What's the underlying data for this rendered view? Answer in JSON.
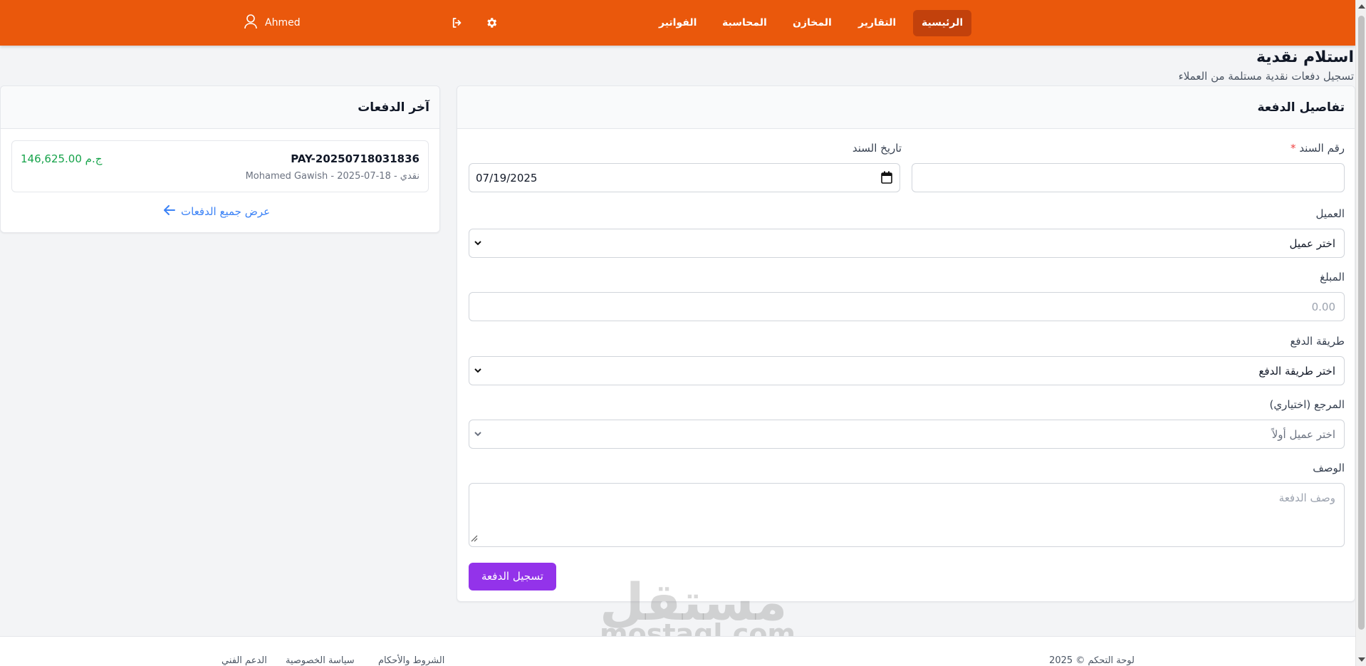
{
  "nav": {
    "items": [
      {
        "label": "الرئيسية",
        "active": true
      },
      {
        "label": "التقارير",
        "active": false
      },
      {
        "label": "المخازن",
        "active": false
      },
      {
        "label": "المحاسبة",
        "active": false
      },
      {
        "label": "الفواتير",
        "active": false
      }
    ],
    "user_name": "Ahmed",
    "icons": [
      "settings-icon",
      "logout-icon",
      "user-icon"
    ],
    "colors": {
      "navbar": "#ea580c",
      "active_item": "#c2410c"
    }
  },
  "page": {
    "title": "استلام نقدية",
    "subtitle": "تسجيل دفعات نقدية مستلمة من العملاء"
  },
  "form": {
    "card_title": "تفاصيل الدفعة",
    "voucher_no_label": "رقم السند",
    "required_mark": "*",
    "voucher_no_value": "",
    "voucher_date_label": "تاريخ السند",
    "voucher_date_value": "07/19/2025",
    "customer_label": "العميل",
    "customer_value": "اختر عميل",
    "amount_label": "المبلغ",
    "amount_placeholder": "0.00",
    "method_label": "طريقة الدفع",
    "method_value": "اختر طريقة الدفع",
    "reference_label": "المرجع (اختياري)",
    "reference_value": "اختر عميل أولاً",
    "description_label": "الوصف",
    "description_placeholder": "وصف الدفعة",
    "submit_label": "تسجيل الدفعة",
    "submit_color": "#9333ea"
  },
  "recent": {
    "card_title": "آخر الدفعات",
    "payments": [
      {
        "number": "PAY-20250718031836",
        "meta": "Mohamed Gawish - نقدي - 18-07-2025",
        "amount": "146,625.00 ج.م",
        "amount_color": "#16a34a"
      }
    ],
    "view_all_label": "عرض جميع الدفعات"
  },
  "watermark": {
    "arabic": "مستقل",
    "latin": "mostaql.com"
  },
  "footer": {
    "copyright": "لوحة التحكم © 2025",
    "links": [
      "الشروط والأحكام",
      "سياسة الخصوصية",
      "الدعم الفني"
    ]
  }
}
